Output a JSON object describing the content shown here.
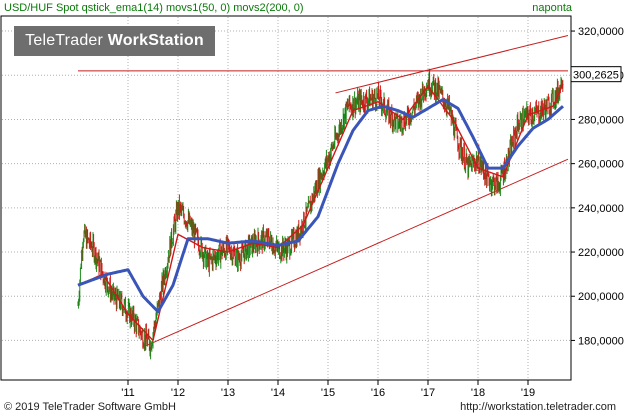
{
  "header": {
    "symbol": "USD/HUF Spot",
    "indicators": "qstick_ema1(14) movs1(50, 0) movs2(200, 0)",
    "period": "naponta"
  },
  "brand": {
    "name_light": "TeleTrader ",
    "name_bold": "WorkStation"
  },
  "footer": {
    "copyright": "© 2019 TeleTrader Software GmbH",
    "url": "http://workstation.teletrader.com"
  },
  "colors": {
    "price_up": "#1a8a1a",
    "price_down": "#d01818",
    "ema": "#d01818",
    "movs": "#3a55b8",
    "trendline": "#c41e1e"
  },
  "chart_data": {
    "type": "line",
    "title": "USD/HUF Spot",
    "last_value": "300,2625",
    "ylim": [
      163000,
      325000
    ],
    "y_ticks": [
      180000,
      200000,
      220000,
      240000,
      260000,
      280000,
      300000,
      320000
    ],
    "y_tick_labels": [
      "180,0000",
      "200,0000",
      "220,0000",
      "240,0000",
      "260,0000",
      "280,0000",
      "300,0000",
      "320,0000"
    ],
    "x_range": [
      2010.0,
      2019.8
    ],
    "x_ticks": [
      2011,
      2012,
      2013,
      2014,
      2015,
      2016,
      2017,
      2018,
      2019
    ],
    "x_tick_labels": [
      "'11",
      "'12",
      "'13",
      "'14",
      "'15",
      "'16",
      "'17",
      "'18",
      "'19"
    ],
    "price_keypoints": {
      "x": [
        2010.0,
        2010.1,
        2010.3,
        2010.5,
        2010.7,
        2010.9,
        2011.1,
        2011.3,
        2011.45,
        2011.6,
        2011.8,
        2012.0,
        2012.2,
        2012.4,
        2012.6,
        2012.8,
        2013.0,
        2013.2,
        2013.4,
        2013.6,
        2013.8,
        2014.0,
        2014.2,
        2014.4,
        2014.6,
        2014.8,
        2015.0,
        2015.2,
        2015.4,
        2015.6,
        2015.8,
        2016.0,
        2016.2,
        2016.4,
        2016.6,
        2016.8,
        2017.0,
        2017.2,
        2017.4,
        2017.6,
        2017.8,
        2018.0,
        2018.2,
        2018.4,
        2018.6,
        2018.8,
        2019.0,
        2019.2,
        2019.4,
        2019.6,
        2019.7
      ],
      "y": [
        196000,
        228000,
        222000,
        210000,
        200000,
        196000,
        190000,
        182000,
        178000,
        195000,
        218000,
        240000,
        234000,
        225000,
        215000,
        219000,
        222000,
        217000,
        222000,
        225000,
        226000,
        221000,
        222000,
        228000,
        238000,
        252000,
        262000,
        274000,
        286000,
        288000,
        289000,
        290000,
        283000,
        278000,
        281000,
        288000,
        297000,
        293000,
        286000,
        270000,
        258000,
        262000,
        253000,
        250000,
        262000,
        278000,
        282000,
        283000,
        286000,
        292000,
        300000
      ]
    },
    "ema_keypoints": {
      "x": [
        2010.0,
        2010.5,
        2011.0,
        2011.5,
        2012.0,
        2012.5,
        2013.0,
        2013.5,
        2014.0,
        2014.5,
        2015.0,
        2015.5,
        2016.0,
        2016.5,
        2017.0,
        2017.5,
        2018.0,
        2018.5,
        2019.0,
        2019.5,
        2019.7
      ],
      "y": [
        205000,
        210000,
        192000,
        180000,
        228000,
        222000,
        220000,
        224000,
        222000,
        232000,
        258000,
        284000,
        288000,
        280000,
        295000,
        280000,
        258000,
        254000,
        282000,
        286000,
        296000
      ]
    },
    "movs_keypoints": {
      "x": [
        2010.0,
        2010.6,
        2011.0,
        2011.3,
        2011.6,
        2011.9,
        2012.2,
        2012.6,
        2013.0,
        2013.5,
        2014.0,
        2014.4,
        2014.8,
        2015.2,
        2015.5,
        2015.8,
        2016.1,
        2016.4,
        2016.7,
        2017.0,
        2017.3,
        2017.6,
        2017.9,
        2018.2,
        2018.5,
        2018.8,
        2019.1,
        2019.4,
        2019.7
      ],
      "y": [
        205000,
        210000,
        212000,
        200000,
        193000,
        205000,
        226000,
        226000,
        224000,
        225000,
        223000,
        225000,
        236000,
        260000,
        275000,
        284000,
        286000,
        284000,
        281000,
        285000,
        289000,
        285000,
        272000,
        258000,
        258000,
        268000,
        276000,
        280000,
        286000
      ]
    },
    "trendlines": [
      {
        "x": [
          2011.3,
          2019.8
        ],
        "y": [
          177000,
          262000
        ]
      },
      {
        "x": [
          2015.15,
          2019.8
        ],
        "y": [
          292000,
          318000
        ]
      },
      {
        "x": [
          2010.0,
          2019.8
        ],
        "y": [
          302000,
          302000
        ]
      }
    ]
  }
}
